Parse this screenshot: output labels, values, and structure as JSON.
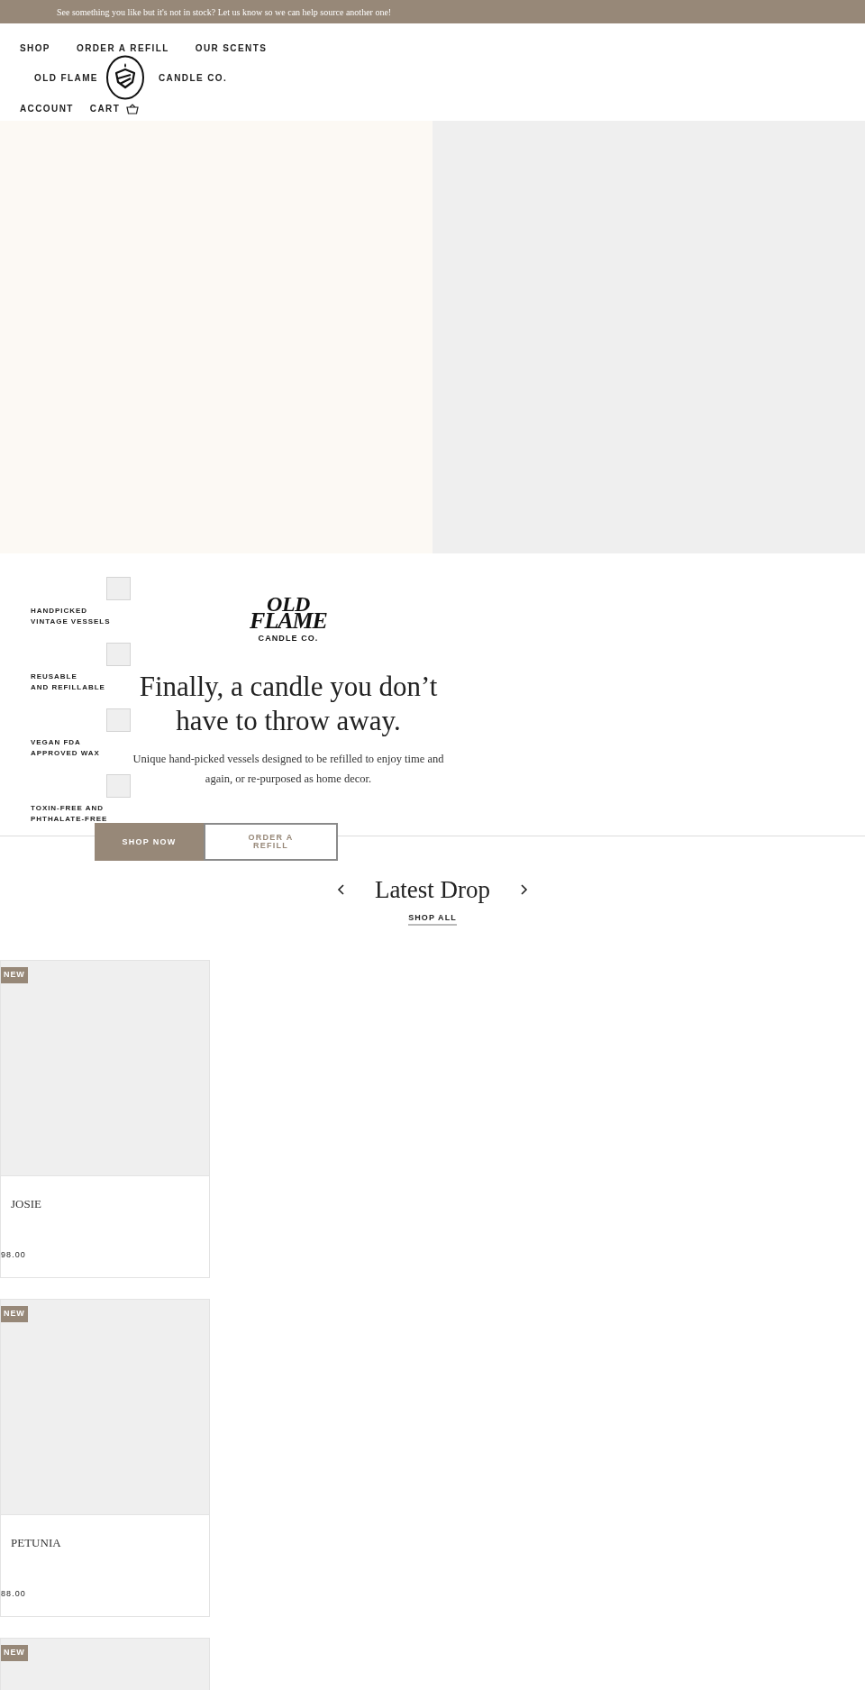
{
  "announcement": "See something you like but it's not in stock? Let us know so we can help source another one!",
  "nav": {
    "links": [
      "SHOP",
      "ORDER A REFILL",
      "OUR SCENTS"
    ],
    "brand_left": "OLD FLAME",
    "brand_right": "CANDLE CO.",
    "account": "ACCOUNT",
    "cart": "CART"
  },
  "features": [
    {
      "line1": "HANDPICKED",
      "line2": "VINTAGE VESSELS"
    },
    {
      "line1": "REUSABLE",
      "line2": "AND REFILLABLE"
    },
    {
      "line1": "VEGAN FDA",
      "line2": "APPROVED WAX"
    },
    {
      "line1": "TOXIN-FREE AND",
      "line2": "PHTHALATE-FREE"
    }
  ],
  "hero": {
    "logo": {
      "top": "OLD",
      "middle": "FLAME",
      "bottom": "CANDLE CO."
    },
    "heading": "Finally, a candle you don’t have to throw away.",
    "text": "Unique hand-picked vessels designed to be refilled to enjoy time and again, or re-purposed as home decor.",
    "buttons": [
      {
        "label": "SHOP NOW",
        "kind": "primary"
      },
      {
        "label": "ORDER A REFILL",
        "kind": "secondary"
      }
    ]
  },
  "latest": {
    "title": "Latest Drop",
    "link": "SHOP ALL"
  },
  "products": [
    {
      "badge": "NEW",
      "name": "JOSIE",
      "price": "98.00"
    },
    {
      "badge": "NEW",
      "name": "PETUNIA",
      "price": "88.00"
    },
    {
      "badge": "NEW"
    }
  ]
}
